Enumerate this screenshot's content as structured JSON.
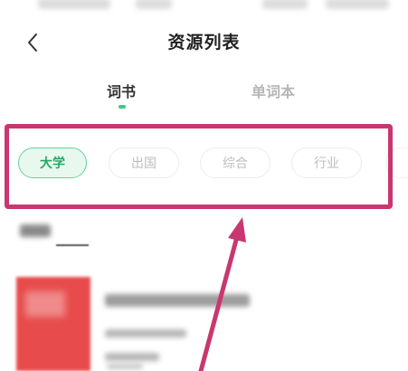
{
  "header": {
    "title": "资源列表"
  },
  "tabs": [
    {
      "label": "词书",
      "active": true
    },
    {
      "label": "单词本",
      "active": false
    }
  ],
  "filter_chips": [
    {
      "label": "大学",
      "selected": true
    },
    {
      "label": "出国",
      "selected": false
    },
    {
      "label": "综合",
      "selected": false
    },
    {
      "label": "行业",
      "selected": false
    }
  ],
  "colors": {
    "accent_green": "#3fc78a",
    "chip_active_text": "#1faa62",
    "annotation_pink": "#c8376f",
    "book_cover_red": "#e84b4b"
  },
  "icons": {
    "back": "chevron-left-icon"
  }
}
